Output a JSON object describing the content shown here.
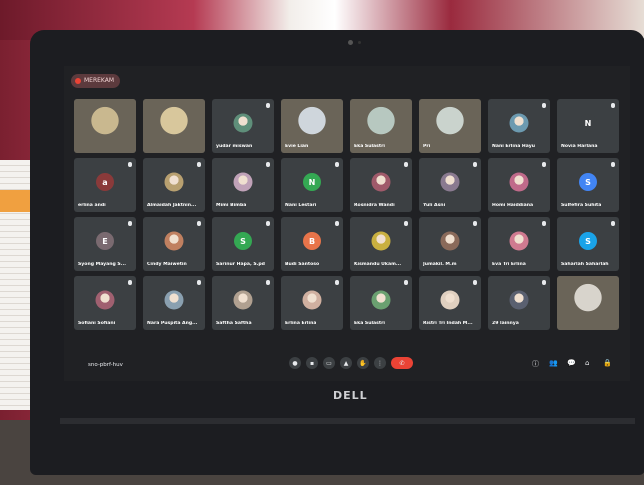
{
  "recording": {
    "label": "MEREKAM"
  },
  "meeting": {
    "code": "sno-pbrf-huv"
  },
  "laptop": {
    "brand": "DELL"
  },
  "participants": [
    {
      "name": "",
      "kind": "video",
      "tone": "#c9b88f"
    },
    {
      "name": "",
      "kind": "video",
      "tone": "#d8c79c"
    },
    {
      "name": "yudar miswan",
      "kind": "photo",
      "tone": "#5f8f7a"
    },
    {
      "name": "Evie Lian",
      "kind": "video",
      "tone": "#cfd6dc"
    },
    {
      "name": "Eka Sulastri",
      "kind": "video",
      "tone": "#b7c8c0"
    },
    {
      "name": "Pri",
      "kind": "video",
      "tone": "#cad3cd"
    },
    {
      "name": "Nani Erlina Hayu",
      "kind": "photo",
      "tone": "#6c9ab0"
    },
    {
      "name": "Novia Harlana",
      "kind": "letter",
      "letter": "N",
      "tone": "#3c4043"
    },
    {
      "name": "erlina andi",
      "kind": "letter",
      "letter": "a",
      "tone": "#8a3a3a"
    },
    {
      "name": "Almaidah Jaktnin...",
      "kind": "photo",
      "tone": "#b8a070"
    },
    {
      "name": "Mimi Bimba",
      "kind": "photo",
      "tone": "#c0a2b8"
    },
    {
      "name": "Nani Lestari",
      "kind": "letter",
      "letter": "N",
      "tone": "#34a853"
    },
    {
      "name": "Rosnidra Wandi",
      "kind": "photo",
      "tone": "#a05a6a"
    },
    {
      "name": "Yuli Asni",
      "kind": "photo",
      "tone": "#8a7a90"
    },
    {
      "name": "Homi Haiddiana",
      "kind": "photo",
      "tone": "#c06a8a"
    },
    {
      "name": "Sulfefira Suhita",
      "kind": "letter",
      "letter": "S",
      "tone": "#4285f4"
    },
    {
      "name": "Syong Mayang S...",
      "kind": "letter",
      "letter": "E",
      "tone": "#7a6a70"
    },
    {
      "name": "Cindy Maiwetin",
      "kind": "photo",
      "tone": "#c08060"
    },
    {
      "name": "Sarinur Hapa, S.pd",
      "kind": "letter",
      "letter": "S",
      "tone": "#34a853"
    },
    {
      "name": "Budi Santoso",
      "kind": "letter",
      "letter": "B",
      "tone": "#e8744a"
    },
    {
      "name": "Kismandu Ukam...",
      "kind": "photo",
      "tone": "#c9b040"
    },
    {
      "name": "Jumakil. M.m",
      "kind": "photo",
      "tone": "#8a6a5a"
    },
    {
      "name": "Eva Tri Erlina",
      "kind": "photo",
      "tone": "#d07a90"
    },
    {
      "name": "Saharlah Saharlah",
      "kind": "letter",
      "letter": "S",
      "tone": "#1aa3e8"
    },
    {
      "name": "Sofiani Sofiani",
      "kind": "photo",
      "tone": "#a06070"
    },
    {
      "name": "Nara Puspita Ang...",
      "kind": "photo",
      "tone": "#8aa0b0"
    },
    {
      "name": "Saftha Saftha",
      "kind": "photo",
      "tone": "#b0a090"
    },
    {
      "name": "Erlina Erlina",
      "kind": "photo",
      "tone": "#d0b0a0"
    },
    {
      "name": "Eka Sulastri",
      "kind": "photo",
      "tone": "#6aa070"
    },
    {
      "name": "Ristri Tri Indah M...",
      "kind": "photo",
      "tone": "#e0d0c0"
    },
    {
      "name": "29 lainnya",
      "kind": "group",
      "tone": "#5a6070"
    },
    {
      "name": "",
      "kind": "video",
      "tone": "#d8d4cc"
    }
  ],
  "controls": {
    "mic_icon": "mic-icon",
    "camera_icon": "camera-icon",
    "captions_icon": "captions-icon",
    "hand_icon": "raise-hand-icon",
    "more_icon": "more-icon",
    "end_icon": "end-call-icon"
  }
}
